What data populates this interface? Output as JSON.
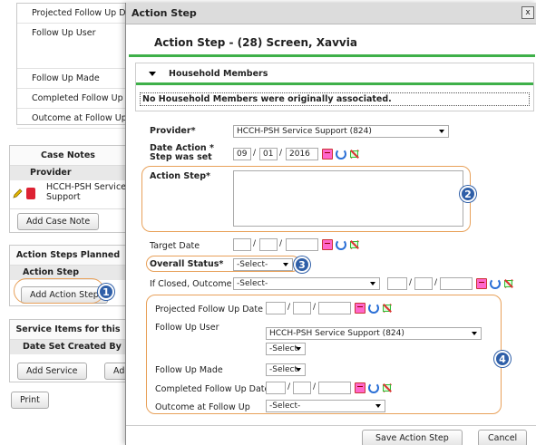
{
  "background": {
    "follow_up_rows": [
      "Projected Follow Up Date",
      "Follow Up User",
      "Follow Up Made",
      "Completed Follow Up Date",
      "Outcome at Follow Up"
    ],
    "case_notes": {
      "title": "Case Notes",
      "col": "Provider",
      "provider": "HCCH-PSH Service Support",
      "add_button": "Add Case Note"
    },
    "action_steps": {
      "title": "Action Steps Planned",
      "col": "Action Step",
      "add_button": "Add Action Step"
    },
    "service_items": {
      "title": "Service Items for this",
      "col": "Date Set Created By",
      "add_button": "Add Service",
      "add_button2": "Add"
    },
    "print_button": "Print"
  },
  "dialog": {
    "title": "Action Step",
    "close_label": "x",
    "header": "Action Step - (28) Screen, Xavvia",
    "household": {
      "title": "Household Members",
      "message": "No Household Members were originally associated."
    },
    "provider": {
      "label": "Provider",
      "value": "HCCH-PSH Service Support (824)"
    },
    "date_set": {
      "label": "Date Action",
      "label2": "Step was set",
      "month": "09",
      "day": "01",
      "year": "2016"
    },
    "action_step": {
      "label": "Action Step",
      "value": ""
    },
    "target_date": {
      "label": "Target Date"
    },
    "overall_status": {
      "label": "Overall Status",
      "value": "-Select-"
    },
    "if_closed": {
      "label": "If Closed, Outcome",
      "value": "-Select-"
    },
    "follow_up": {
      "projected_label": "Projected Follow Up Date",
      "user_label": "Follow Up User",
      "user_value": "HCCH-PSH Service Support (824)",
      "user_value2": "-Select-",
      "made_label": "Follow Up Made",
      "made_value": "-Select-",
      "completed_label": "Completed Follow Up Date",
      "outcome_label": "Outcome at Follow Up",
      "outcome_value": "-Select-"
    },
    "required_mark": "*",
    "date_sep": "/",
    "buttons": {
      "save": "Save Action Step",
      "cancel": "Cancel"
    }
  },
  "badges": [
    "1",
    "2",
    "3",
    "4"
  ],
  "colors": {
    "accent_green": "#3eb049",
    "callout_orange": "#e8a15a",
    "badge_blue": "#2f5fa8"
  }
}
